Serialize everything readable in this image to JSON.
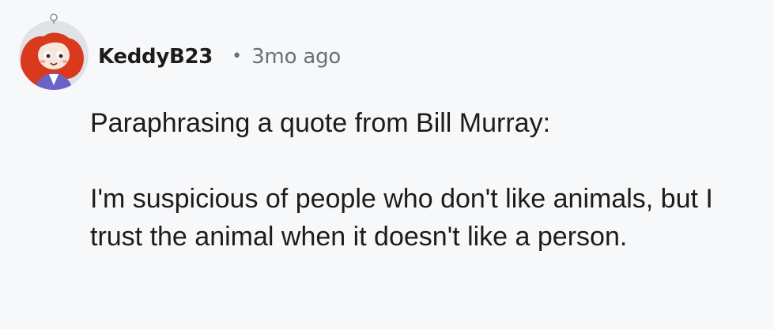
{
  "comment": {
    "author": "KeddyB23",
    "separator": "•",
    "timestamp": "3mo ago",
    "avatar": "user-avatar-red-haired-character",
    "paragraphs": [
      "Paraphrasing a quote from Bill Murray:",
      "I'm suspicious of people who don't like animals, but I trust the animal when it doesn't like a person."
    ]
  },
  "colors": {
    "background": "#f7f8fa",
    "text": "#1c1c1c",
    "muted": "#6b7075",
    "avatar_bg": "#dfe3e8",
    "hair": "#d93a1e",
    "shirt": "#6b63c7"
  }
}
